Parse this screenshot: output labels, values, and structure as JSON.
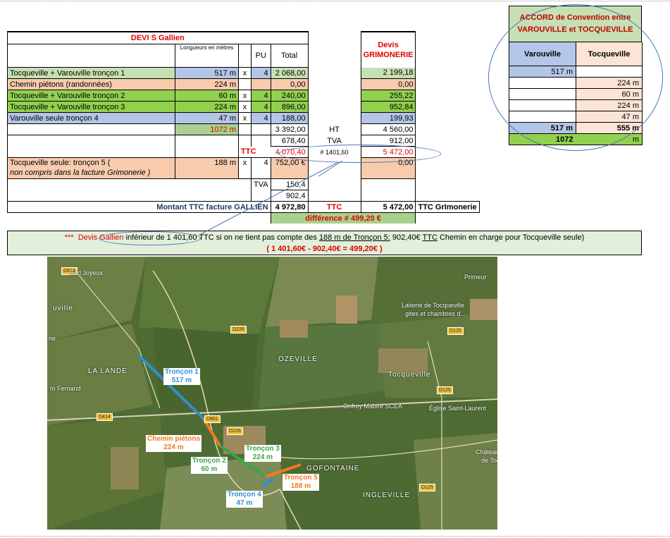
{
  "header": {
    "devis_gallien": "DEVI S     Gallien",
    "longueurs": "Longueurs en mètres",
    "pu": "PU",
    "total": "Total",
    "devis_grim_1": "Devis",
    "devis_grim_2": "GRIMONERIE"
  },
  "rows": [
    {
      "label": "Tocqueville + Varouville    tronçon 1",
      "len": "517  m",
      "x": "x",
      "pu": "4",
      "total": "2 068,00",
      "grim": "2 199,18"
    },
    {
      "label": "Chemin piétons (randonnées)",
      "len": "224  m",
      "x": "",
      "pu": "",
      "total": "0,00",
      "grim": "0,00"
    },
    {
      "label": "Tocqueville + Varouville    tronçon 2",
      "len": "60  m",
      "x": "x",
      "pu": "4",
      "total": "240,00",
      "grim": "255,22"
    },
    {
      "label": "Tocqueville + Varouville    tronçon 3",
      "len": "224  m",
      "x": "x",
      "pu": "4",
      "total": "896,00",
      "grim": "952,84"
    },
    {
      "label": "Varouville seule               tronçon 4",
      "len": "47  m",
      "x": "x",
      "pu": "4",
      "total": "188,00",
      "grim": "199,93"
    }
  ],
  "totals": {
    "sum_len": "1072  m",
    "ht_total": "3 392,00",
    "ht": "HT",
    "ht_grim": "4 560,00",
    "tva_total": "678,40",
    "tva": "TVA",
    "tva_grim": "912,00",
    "ttc": "TTC",
    "ttc_total": "4 070,40",
    "diff_small": "# 1401,60",
    "ttc_grim": "5 472,00"
  },
  "troncon5": {
    "label1": "Tocqueville seule:        tronçon 5         (",
    "label2": "non compris dans la facture Grimonerie )",
    "len": "188  m",
    "x": "x",
    "pu": "4",
    "total": "752,00 €",
    "grim": "0,00"
  },
  "tva5": {
    "label": "TVA",
    "value": "150,4",
    "ttc": "902,4"
  },
  "montant": {
    "label": "Montant TTC facture GALLIEN",
    "value": "4 972,80",
    "ttc": "TTC",
    "grim": "5 472,00",
    "grim_label": "TTC GrImonerie"
  },
  "difference": {
    "label": "différence  #    499,20 €"
  },
  "note": {
    "stars": "***",
    "devis_g": "Devis Gallien",
    "part1": " inférieur de 1 401,60  TTC si on ne tient pas compte des ",
    "u1": "188 m de Tronçon 5:",
    "part2": "   902,40€ ",
    "u2": "TTC",
    "part3": " Chemin en charge pour Tocqueville seule)",
    "line2": "( 1 401,60€  -  902,40€  =   499,20€  )"
  },
  "accord": {
    "line1": "ACCORD de Convention        entre",
    "line2": "VAROUVILLE et TOCQUEVILLE",
    "col1": "Varouville",
    "col2": "Tocqueville",
    "rows": [
      [
        "517  m",
        ""
      ],
      [
        "",
        "224  m"
      ],
      [
        "",
        "60  m"
      ],
      [
        "",
        "224  m"
      ],
      [
        "",
        "47  m"
      ]
    ],
    "sum": [
      "517  m",
      "555  m"
    ],
    "total": "1072",
    "unit": "m"
  },
  "map": {
    "labels": {
      "t1a": "Tronçon 1",
      "t1b": "517 m",
      "cp1": "Chemin piétons",
      "cp2": "224 m",
      "t2a": "Tronçon 2",
      "t2b": "60 m",
      "t3a": "Tronçon 3",
      "t3b": "224 m",
      "t4a": "Tronçon 4",
      "t4b": "47 m",
      "t5a": "Tronçon 5",
      "t5b": "188 m"
    },
    "places": {
      "earl": "Earl Joyeux",
      "ouville": "uville",
      "lalande": "LA LANDE",
      "fernand": "m Fernand",
      "ozeville": "OZEVILLE",
      "tocqueville": "Tocqueville",
      "laiterie1": "Laiterie de Tocqueville",
      "laiterie2": "gites et chambres d...",
      "primeur": "Primeur",
      "onfroy": "Onfroy Mabire SCEA",
      "eglise": "Église Saint-Laurent",
      "gofontaine": "GOFONTAINE",
      "ingleville": "INGLEVILLE",
      "chateau1": "Château",
      "chateau2": "de Toc",
      "ne": "ne"
    },
    "roads": [
      "D514",
      "D226",
      "D125",
      "D414",
      "D901",
      "D226",
      "D125",
      "D125"
    ],
    "colors": {
      "blue": "#2f8fd6",
      "orange": "#f07a22",
      "green": "#3aa548"
    }
  }
}
